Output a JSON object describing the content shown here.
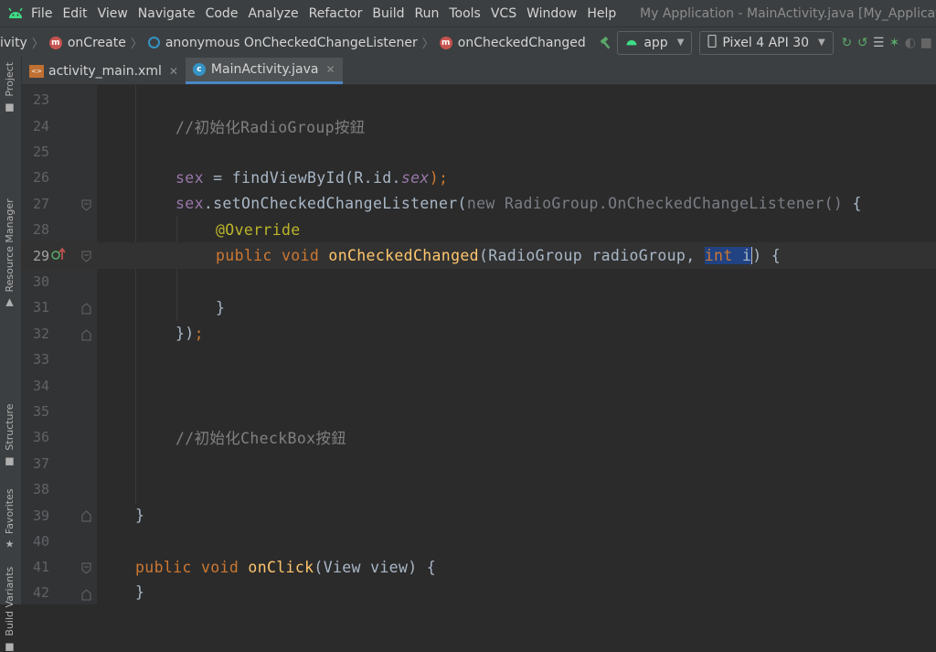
{
  "window_title": "My Application - MainActivity.java [My_Application",
  "menu": [
    "File",
    "Edit",
    "View",
    "Navigate",
    "Code",
    "Analyze",
    "Refactor",
    "Build",
    "Run",
    "Tools",
    "VCS",
    "Window",
    "Help"
  ],
  "breadcrumb": {
    "b0": "ivity",
    "b1": "onCreate",
    "b2": "anonymous OnCheckedChangeListener",
    "b3": "onCheckedChanged"
  },
  "run_config": "app",
  "device": "Pixel 4 API 30",
  "tabs": [
    {
      "label": "activity_main.xml"
    },
    {
      "label": "MainActivity.java"
    }
  ],
  "side_panels": {
    "project": "Project",
    "resource_manager": "Resource Manager",
    "structure": "Structure",
    "favorites": "Favorites",
    "build_variants": "Build Variants"
  },
  "editor": {
    "line_numbers": [
      "23",
      "24",
      "25",
      "26",
      "27",
      "28",
      "29",
      "30",
      "31",
      "32",
      "33",
      "34",
      "35",
      "36",
      "37",
      "38",
      "39",
      "40",
      "41",
      "42"
    ],
    "current_line": "29",
    "tokens": {
      "l24_comment": "//初始化RadioGroup按鈕",
      "l26_sex": "sex",
      "l26_mid": " = findViewById(R.id.",
      "l26_field": "sex",
      "l26_end": ");",
      "l27_sex": "sex",
      "l27_call": ".setOnCheckedChangeListener(",
      "l27_new": "new RadioGroup.OnCheckedChangeListener()",
      "l27_brace": " {",
      "l28_ann": "@Override",
      "l29_public": "public void ",
      "l29_fn": "onCheckedChanged",
      "l29_params": "(RadioGroup radioGroup, ",
      "l29_int": "int",
      "l29_sp": " ",
      "l29_i": "i",
      "l29_end": ") {",
      "l31": "}",
      "l32_a": "})",
      "l32_b": ";",
      "l36_comment": "//初始化CheckBox按鈕",
      "l39": "}",
      "l41_public": "public void ",
      "l41_fn": "onClick",
      "l41_rest": "(View view) {",
      "l42": "}"
    }
  },
  "colors": {
    "background": "#2b2b2b",
    "keyword": "#cc7832",
    "comment": "#808080",
    "field": "#9876aa",
    "method": "#ffc66d",
    "annotation": "#bbb529",
    "selection": "#214283"
  }
}
